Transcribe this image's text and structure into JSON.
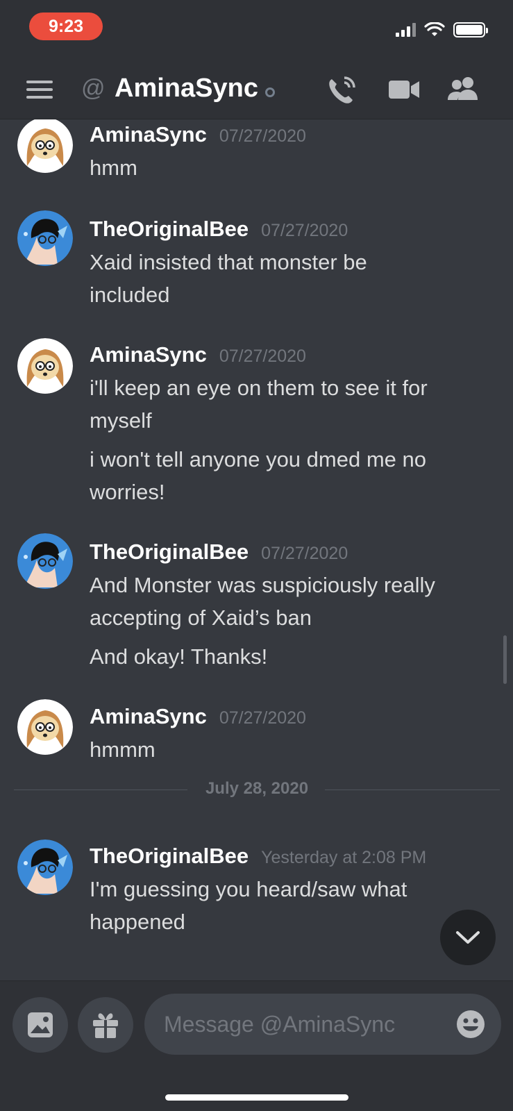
{
  "status_bar": {
    "time": "9:23"
  },
  "header": {
    "at_symbol": "@",
    "title": "AminaSync"
  },
  "messages": [
    {
      "username": "AminaSync",
      "timestamp": "07/27/2020",
      "lines": [
        "hmm"
      ]
    },
    {
      "username": "TheOriginalBee",
      "timestamp": "07/27/2020",
      "lines": [
        "Xaid insisted that monster be",
        "included"
      ]
    },
    {
      "username": "AminaSync",
      "timestamp": "07/27/2020",
      "lines": [
        "i'll keep an eye on them to see it for",
        "myself",
        "i won't tell anyone you dmed me no",
        "worries!"
      ]
    },
    {
      "username": "TheOriginalBee",
      "timestamp": "07/27/2020",
      "lines": [
        "And Monster was suspiciously really",
        "accepting of Xaid’s ban",
        "And okay! Thanks!"
      ]
    },
    {
      "username": "AminaSync",
      "timestamp": "07/27/2020",
      "lines": [
        "hmmm"
      ]
    },
    {
      "username": "TheOriginalBee",
      "timestamp": "Yesterday at 2:08 PM",
      "lines": [
        "I'm guessing you heard/saw what",
        "happened"
      ]
    }
  ],
  "date_divider": "July 28, 2020",
  "composer": {
    "placeholder": "Message @AminaSync"
  },
  "colors": {
    "background": "#36393f",
    "header": "#2f3136",
    "time_pill": "#eb4d3d",
    "bee_avatar": "#3b8ad8"
  }
}
